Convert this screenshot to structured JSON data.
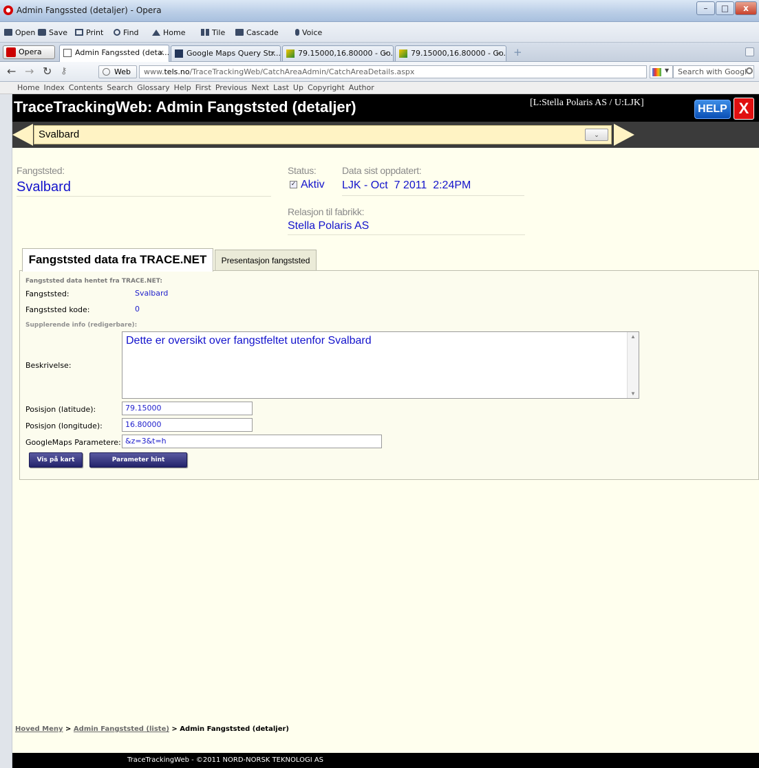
{
  "window": {
    "title": "Admin Fangssted (detaljer) - Opera",
    "min": "–",
    "max": "□",
    "close": "x"
  },
  "menubar": {
    "items": [
      "Open",
      "Save",
      "Print",
      "Find",
      "Home",
      "Tile",
      "Cascade",
      "Voice"
    ]
  },
  "tabs": {
    "menu_label": "Opera",
    "items": [
      {
        "label": "Admin Fangssted (deta...",
        "close": "×"
      },
      {
        "label": "Google Maps Query Str...",
        "close": "×"
      },
      {
        "label": "79.15000,16.80000 - Go...",
        "close": "×"
      },
      {
        "label": "79.15000,16.80000 - Go...",
        "close": "×"
      }
    ],
    "new_tab": "+"
  },
  "address": {
    "web_label": "Web",
    "url_prefix": "www.",
    "url_domain": "tels.no",
    "url_path": "/TraceTrackingWeb/CatchAreaAdmin/CatchAreaDetails.aspx",
    "search_placeholder": "Search with Googl"
  },
  "navlinks": [
    "Home",
    "Index",
    "Contents",
    "Search",
    "Glossary",
    "Help",
    "First",
    "Previous",
    "Next",
    "Last",
    "Up",
    "Copyright",
    "Author"
  ],
  "header": {
    "title": "TraceTrackingWeb: Admin Fangststed (detaljer)",
    "user": "[L:Stella Polaris AS / U:LJK]",
    "help": "HELP",
    "close": "X"
  },
  "selector": {
    "value": "Svalbard",
    "chevron": "⌄"
  },
  "summary": {
    "fangststed_label": "Fangststed:",
    "fangststed_value": "Svalbard",
    "status_label": "Status:",
    "status_value": "Aktiv",
    "updated_label": "Data sist oppdatert:",
    "updated_value": "LJK - Oct  7 2011  2:24PM",
    "relation_label": "Relasjon til fabrikk:",
    "relation_value": "Stella Polaris AS"
  },
  "page_tabs": {
    "active": "Fangststed data fra TRACE.NET",
    "inactive": "Presentasjon fangststed"
  },
  "details": {
    "section1": "Fangststed data hentet fra TRACE.NET:",
    "fangststed_label": "Fangststed:",
    "fangststed_value": "Svalbard",
    "kode_label": "Fangststed kode:",
    "kode_value": "0",
    "section2": "Supplerende info (redigerbare):",
    "beskrivelse_label": "Beskrivelse:",
    "beskrivelse_value": "Dette er oversikt over fangstfeltet utenfor Svalbard",
    "lat_label": "Posisjon (latitude):",
    "lat_value": "79.15000",
    "lon_label": "Posisjon (longitude):",
    "lon_value": "16.80000",
    "gm_label": "GoogleMaps Parametere:",
    "gm_value": "&z=3&t=h",
    "btn_map": "Vis på kart",
    "btn_hint": "Parameter hint"
  },
  "breadcrumb": {
    "home": "Hoved Meny",
    "sep": ">",
    "list": "Admin Fangststed (liste)",
    "current": "Admin Fangststed (detaljer)"
  },
  "footer": "TraceTrackingWeb - ©2011 NORD-NORSK TEKNOLOGI AS",
  "colors": {
    "value_blue": "#1212cc",
    "page_bg": "#ffffee",
    "selector_bg": "#fff3c4",
    "header_bg": "#000000"
  }
}
